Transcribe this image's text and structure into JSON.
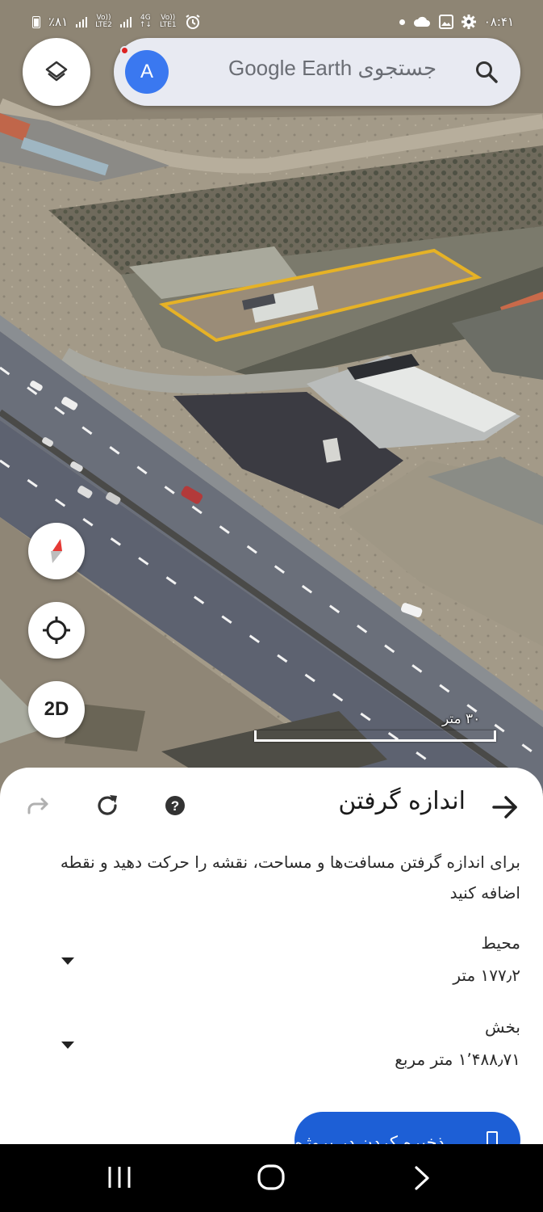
{
  "status_bar": {
    "time": "۰۸:۴۱",
    "battery": "٪۸۱",
    "sim2_label_top": "Vo))",
    "sim2_label_bottom": "LTE2",
    "sim1_network": "4G",
    "sim1_label_top": "Vo))",
    "sim1_label_bottom": "LTE1",
    "icons": [
      "alarm-icon",
      "dot-icon",
      "cloud-icon",
      "gallery-icon",
      "settings-icon"
    ]
  },
  "top": {
    "layers_icon": "layers-icon",
    "avatar_letter": "A",
    "search_placeholder": "جستجوی Google Earth",
    "search_icon": "search-icon"
  },
  "controls": {
    "compass_icon": "compass-icon",
    "locate_icon": "my-location-icon",
    "view_mode_label": "2D"
  },
  "scale": {
    "label": "۳۰ متر"
  },
  "measure_panel": {
    "title": "اندازه گرفتن",
    "instructions": "برای اندازه گرفتن مسافت‌ها و مساحت، نقشه را حرکت دهید و نقطه اضافه کنید",
    "perimeter": {
      "label": "محیط",
      "value": "۱۷۷٫۲ متر"
    },
    "area": {
      "label": "بخش",
      "value": "۱٬۴۸۸٫۷۱ متر مربع"
    },
    "save_label": "ذخیره کردن در پروژه",
    "accent_color": "#1d5fd6",
    "selection_outline_color": "#e6b226"
  },
  "nav_bar": {
    "icons": [
      "recents-icon",
      "home-icon",
      "back-icon"
    ]
  }
}
